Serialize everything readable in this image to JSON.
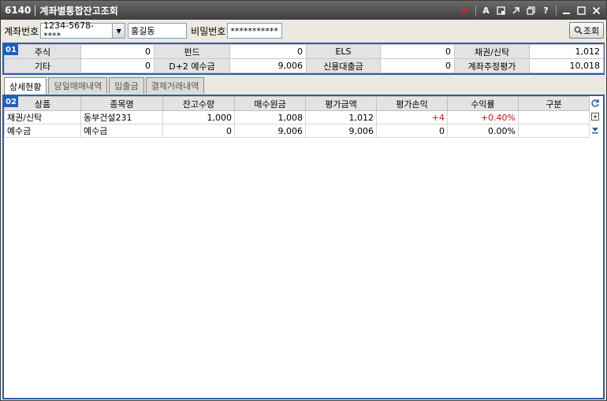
{
  "window": {
    "screen_code": "6140",
    "title": "계좌별통합잔고조회"
  },
  "toolbar": {
    "icons": [
      "red-triangle-icon",
      "font-icon",
      "capture-icon",
      "link-icon",
      "restore-icon",
      "help-icon",
      "minimize-icon",
      "maximize-icon",
      "close-icon"
    ],
    "help_label": "?"
  },
  "account_bar": {
    "account_label": "계좌번호",
    "account_value": "1234-5678-****",
    "name_value": "홍길동",
    "password_label": "비밀번호",
    "password_value": "***********",
    "query_button": "조회"
  },
  "summary": {
    "badge": "01",
    "row1": [
      {
        "label": "주식",
        "value": "0"
      },
      {
        "label": "펀드",
        "value": "0"
      },
      {
        "label": "ELS",
        "value": "0"
      },
      {
        "label": "채권/신탁",
        "value": "1,012"
      }
    ],
    "row2": [
      {
        "label": "기타",
        "value": "0"
      },
      {
        "label": "D+2 예수금",
        "value": "9,006"
      },
      {
        "label": "신용대출금",
        "value": "0"
      },
      {
        "label": "계좌추정평가",
        "value": "10,018"
      }
    ]
  },
  "tabs": [
    "상세현황",
    "당일매매내역",
    "입출금",
    "결제거래내역"
  ],
  "detail": {
    "badge": "02",
    "columns": [
      "상품",
      "종목명",
      "잔고수량",
      "매수원금",
      "평가금액",
      "평가손익",
      "수익률",
      "구분"
    ],
    "rows": [
      [
        "채권/신탁",
        "동부건설231",
        "1,000",
        "1,008",
        "1,012",
        "+4",
        "+0.40%",
        ""
      ],
      [
        "예수금",
        "예수금",
        "0",
        "9,006",
        "9,006",
        "0",
        "0.00%",
        ""
      ]
    ]
  },
  "colors": {
    "accent_blue": "#2b5fae",
    "positive_red": "#d01010"
  }
}
